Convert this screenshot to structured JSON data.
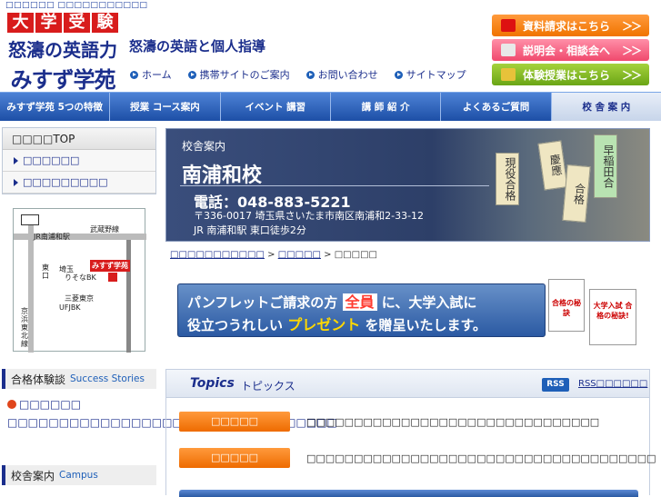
{
  "top_caption": "□□□□□□ □□□□□□□□□□□",
  "logo": {
    "box_chars": [
      "大",
      "学",
      "受",
      "験"
    ],
    "line2": "怒濤の英語力",
    "line3": "みすず学苑"
  },
  "tagline": "怒濤の英語と個人指導",
  "header_links": [
    "ホーム",
    "携帯サイトのご案内",
    "お問い合わせ",
    "サイトマップ"
  ],
  "cta": {
    "request": "資料請求はこちら",
    "briefing": "説明会・相談会へ",
    "trial": "体験授業はこちら",
    "arrow": "＞＞"
  },
  "global_nav": [
    "みすず学苑 5つの特徴",
    "授業 コース案内",
    "イベント 講習",
    "講 師 紹 介",
    "よくあるご質問",
    "校 舎 案 内"
  ],
  "sidebar": {
    "top_label": "□□□□TOP",
    "links": [
      "□□□□□□",
      "□□□□□□□□□"
    ],
    "map_labels": {
      "line_musashino": "武蔵野線",
      "station": "JR南浦和駅",
      "east_exit": "東口",
      "saitama": "埼玉",
      "resona": "りそなBK",
      "misuzu": "みすず学苑",
      "mitsubishi": "三菱東京",
      "ufj": "UFJBK",
      "keihin": "京浜東北線"
    },
    "success_head": {
      "ja": "合格体験談",
      "en": "Success Stories"
    },
    "success_items": [
      "□□□□□□",
      "□□□□□□□□□□□□□□□□□□□□□□□□□□□□□□□□"
    ],
    "campus_head": {
      "ja": "校舎案内",
      "en": "Campus"
    }
  },
  "banner": {
    "label": "校舎案内",
    "title": "南浦和校",
    "phone": "電話：048-883-5221",
    "address": "〒336-0017  埼玉県さいたま市南区南浦和2-33-12",
    "station": "JR 南浦和駅 東口徒歩2分",
    "ema": [
      "早稲田合",
      "合格",
      "慶應",
      "現役合格"
    ]
  },
  "breadcrumb": {
    "links": [
      "□□□□□□□□□□□",
      "□□□□□"
    ],
    "sep": ">",
    "current": "□□□□□"
  },
  "promo": {
    "l1_pre": "パンフレットご請求の方",
    "l1_hl": "全員",
    "l1_post": "に、大学入試に",
    "l2_pre": "役立つうれしい",
    "l2_hl": "プレゼント",
    "l2_post": "を贈呈いたします。",
    "book1": "大学入試 合格の秘訣!",
    "book2": "合格の秘訣"
  },
  "topics": {
    "title_en": "Topics",
    "title_ja": "トピックス",
    "rss_badge": "RSS",
    "rss_link": "RSS□□□□□□",
    "items": [
      {
        "tag": "□□□□□",
        "text": "□□□□□□□□□□□□□□□□□□□□□□□□□□□□□□□"
      },
      {
        "tag": "□□□□□",
        "text": "□□□□□□□□□□□□□□□□□□□□□□□□□□□□□□□□□□□□□"
      }
    ]
  }
}
